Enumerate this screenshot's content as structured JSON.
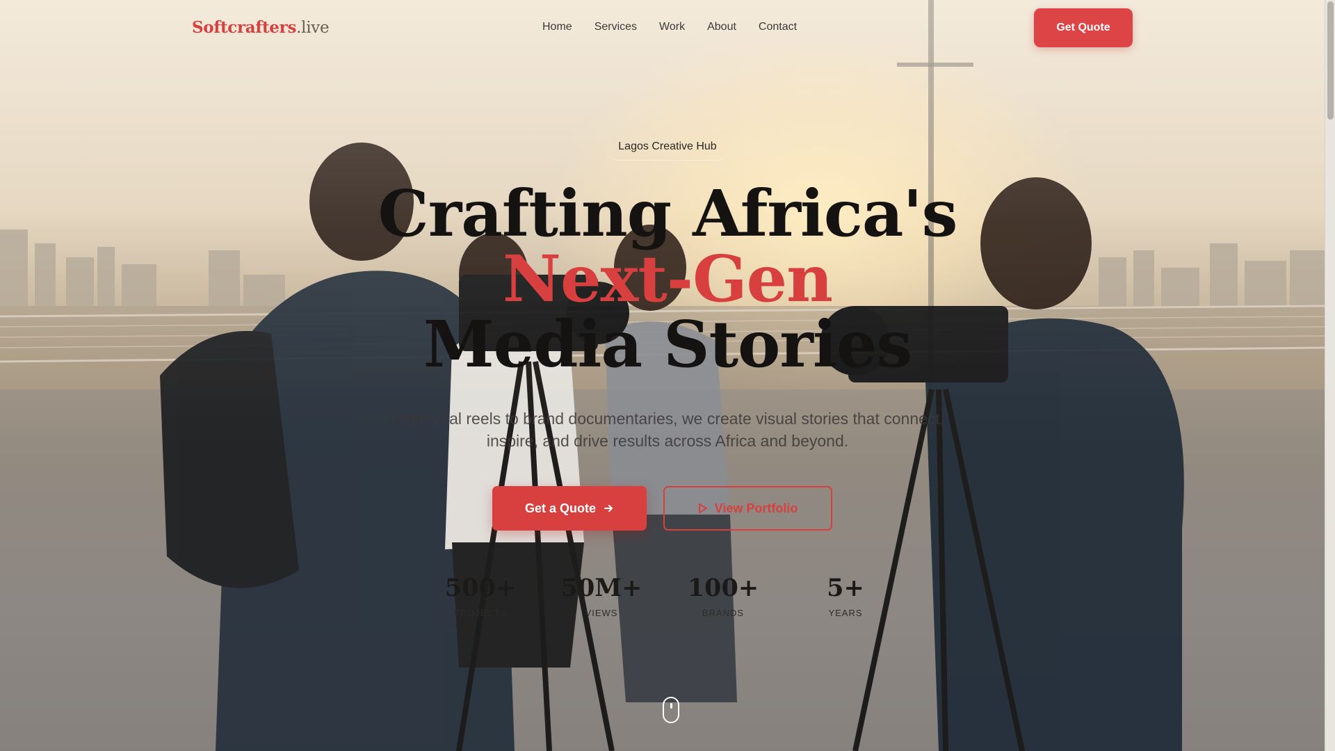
{
  "brand": {
    "name": "Softcrafters",
    "tld": ".live"
  },
  "nav": {
    "items": [
      {
        "label": "Home"
      },
      {
        "label": "Services"
      },
      {
        "label": "Work"
      },
      {
        "label": "About"
      },
      {
        "label": "Contact"
      }
    ],
    "cta_label": "Get Quote"
  },
  "hero": {
    "badge": "Lagos Creative Hub",
    "headline_part1": "Crafting Africa's ",
    "headline_accent": "Next-Gen",
    "headline_part2": "Media Stories",
    "subtitle": "From viral reels to brand documentaries, we create visual stories that connect, inspire, and drive results across Africa and beyond.",
    "primary_cta": "Get a Quote",
    "primary_cta_icon": "arrow-right-icon",
    "secondary_cta": "View Portfolio",
    "secondary_cta_icon": "play-icon"
  },
  "stats": [
    {
      "value": "500+",
      "label": "Projects"
    },
    {
      "value": "50M+",
      "label": "Views"
    },
    {
      "value": "100+",
      "label": "Brands"
    },
    {
      "value": "5+",
      "label": "Years"
    }
  ],
  "colors": {
    "accent": "#d8403f",
    "text_dark": "#151311"
  }
}
